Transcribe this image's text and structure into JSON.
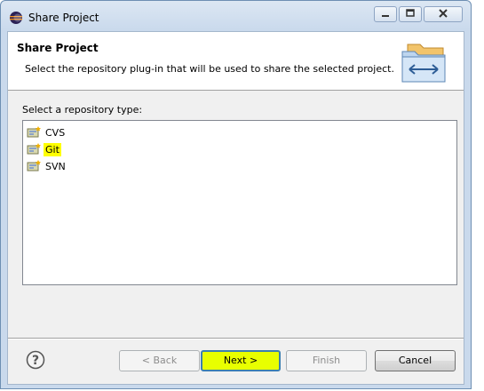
{
  "window": {
    "title": "Share Project"
  },
  "banner": {
    "title": "Share Project",
    "description": "Select the repository plug-in that will be used to share the selected project."
  },
  "list": {
    "label": "Select a repository type:",
    "items": [
      {
        "label": "CVS",
        "selected": false
      },
      {
        "label": "Git",
        "selected": true
      },
      {
        "label": "SVN",
        "selected": false
      }
    ]
  },
  "buttons": {
    "back": "< Back",
    "next": "Next >",
    "finish": "Finish",
    "cancel": "Cancel"
  },
  "icons": {
    "app": "eclipse-icon",
    "banner": "shared-folders-icon",
    "help": "help-icon",
    "repository": "repository-icon"
  },
  "colors": {
    "highlight": "#ffff00",
    "next_button": "#e8ff00"
  }
}
